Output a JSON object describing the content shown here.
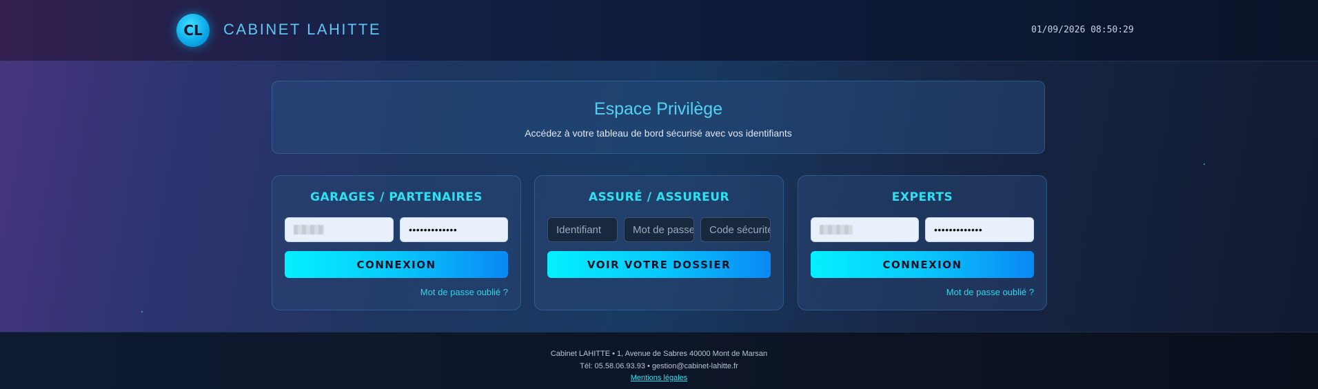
{
  "header": {
    "logo_initials": "CL",
    "brand_name": "CABINET LAHITTE",
    "datetime": "01/09/2026 08:50:29"
  },
  "hero": {
    "title": "Espace Privilège",
    "subtitle": "Accédez à votre tableau de bord sécurisé avec vos identifiants"
  },
  "cards": [
    {
      "title": "GARAGES / PARTENAIRES",
      "password_value": "•••••••••••••",
      "button_label": "CONNEXION",
      "forgot_label": "Mot de passe oublié ?"
    },
    {
      "title": "ASSURÉ / ASSUREUR",
      "placeholders": [
        "Identifiant",
        "Mot de passe",
        "Code sécurité"
      ],
      "button_label": "VOIR VOTRE DOSSIER"
    },
    {
      "title": "EXPERTS",
      "password_value": "•••••••••••••",
      "button_label": "CONNEXION",
      "forgot_label": "Mot de passe oublié ?"
    }
  ],
  "footer": {
    "address": "Cabinet LAHITTE • 1, Avenue de Sabres 40000 Mont de Marsan",
    "contact": "Tél: 05.58.06.93.93 • gestion@cabinet-lahitte.fr",
    "legal_link": "Mentions légales"
  },
  "colors": {
    "accent": "#2ee0f0",
    "button_start": "#05f0ff",
    "button_end": "#0a88f4"
  }
}
